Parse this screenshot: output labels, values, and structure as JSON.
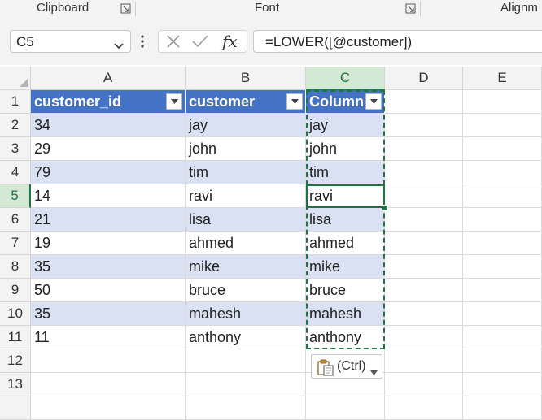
{
  "ribbon": {
    "groups": [
      "Clipboard",
      "Font",
      "Alignm"
    ]
  },
  "formula_bar": {
    "name_box": "C5",
    "fx_label": "fx",
    "formula": "=LOWER([@customer])"
  },
  "sheet": {
    "columns": [
      "A",
      "B",
      "C",
      "D",
      "E"
    ],
    "rows": [
      "1",
      "2",
      "3",
      "4",
      "5",
      "6",
      "7",
      "8",
      "9",
      "10",
      "11",
      "12",
      "13"
    ],
    "selected_column": "C",
    "selected_row": "5",
    "table_headers": [
      "customer_id",
      "customer",
      "Column1"
    ],
    "data": [
      [
        "34",
        "jay",
        "jay"
      ],
      [
        "29",
        "john",
        "john"
      ],
      [
        "79",
        "tim",
        "tim"
      ],
      [
        "14",
        "ravi",
        "ravi"
      ],
      [
        "21",
        "lisa",
        "lisa"
      ],
      [
        "19",
        "ahmed",
        "ahmed"
      ],
      [
        "35",
        "mike",
        "mike"
      ],
      [
        "50",
        "bruce",
        "bruce"
      ],
      [
        "35",
        "mahesh",
        "mahesh"
      ],
      [
        "11",
        "anthony",
        "anthony"
      ]
    ]
  },
  "paste_options": {
    "label": "(Ctrl)",
    "icon": "clipboard-icon"
  },
  "colors": {
    "header_fill": "#4472c4",
    "band_fill": "#d9e1f2",
    "selection_green": "#217346"
  }
}
